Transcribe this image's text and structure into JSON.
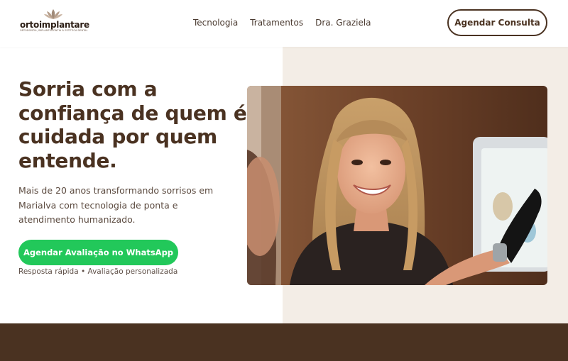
{
  "brand": {
    "name": "ortoimplantare",
    "tagline": "ORTODONTIA, IMPLANTODONTIA & ESTÉTICA DENTAL"
  },
  "nav": {
    "items": [
      {
        "label": "Tecnologia"
      },
      {
        "label": "Tratamentos"
      },
      {
        "label": "Dra. Graziela"
      }
    ]
  },
  "header": {
    "cta_label": "Agendar Consulta"
  },
  "hero": {
    "headline": "Sorria com a confiança de quem é cuidada por quem entende.",
    "subtext": "Mais de 20 anos transformando sorrisos em Marialva com tecnologia de ponta e atendimento humanizado.",
    "whatsapp_cta": "Agendar Avaliação no WhatsApp",
    "note": "Resposta rápida • Avaliação personalizada",
    "photo_icon": "photo-dentist-with-patient"
  },
  "colors": {
    "brand_brown": "#4a3221",
    "whatsapp_green": "#22c85a",
    "hero_right_bg": "#f3ede6"
  }
}
